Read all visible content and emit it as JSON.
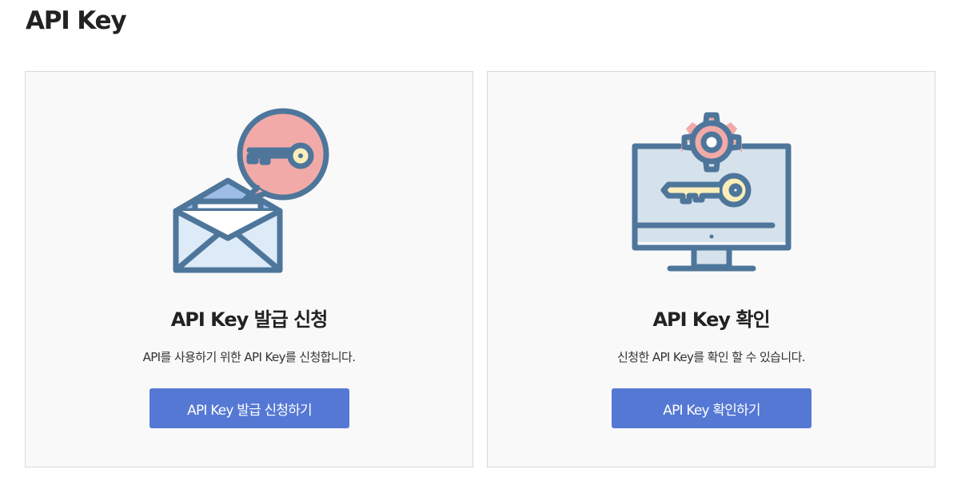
{
  "page": {
    "title": "API Key"
  },
  "cards": [
    {
      "icon": "envelope-key-icon",
      "title": "API Key 발급 신청",
      "description": "API를 사용하기 위한 API Key를 신청합니다.",
      "button_label": "API Key 발급 신청하기"
    },
    {
      "icon": "monitor-key-gear-icon",
      "title": "API Key 확인",
      "description": "신청한 API Key를 확인 할 수 있습니다.",
      "button_label": "API Key 확인하기"
    }
  ],
  "colors": {
    "button": "#5578d4",
    "card_background": "#f9f9f9",
    "card_border": "#d8d8d8",
    "icon_outline": "#4e769b",
    "icon_pink": "#f2aaa8",
    "icon_key": "#fbeeb8",
    "icon_light_blue": "#d9e8f5"
  }
}
